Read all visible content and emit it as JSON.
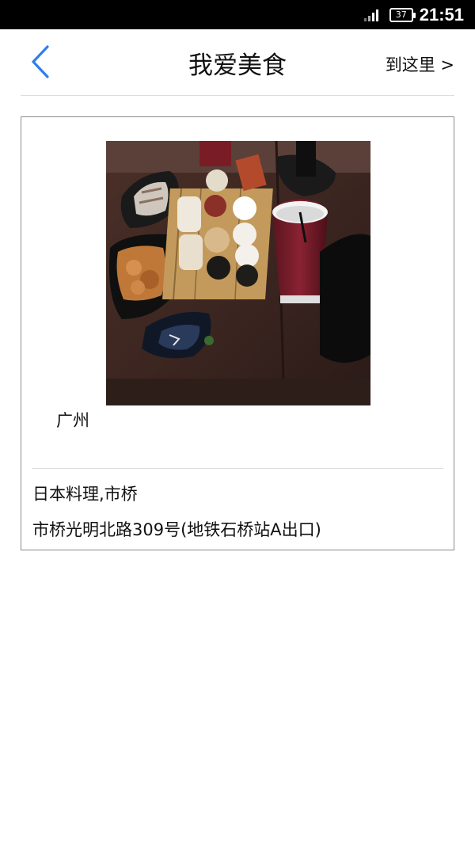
{
  "status_bar": {
    "battery": "37",
    "time": "21:51"
  },
  "header": {
    "title": "我爱美食",
    "right_link": "到这里 >",
    "back_icon": "chevron-left-icon"
  },
  "card": {
    "city": "广州",
    "name": "日本料理,市桥",
    "address": "市桥光明北路309号(地铁石桥站A出口)"
  },
  "colors": {
    "accent": "#2f7fe8",
    "status_bar": "#000000",
    "divider": "#dcdcdc",
    "card_border": "#8a8a8a"
  }
}
